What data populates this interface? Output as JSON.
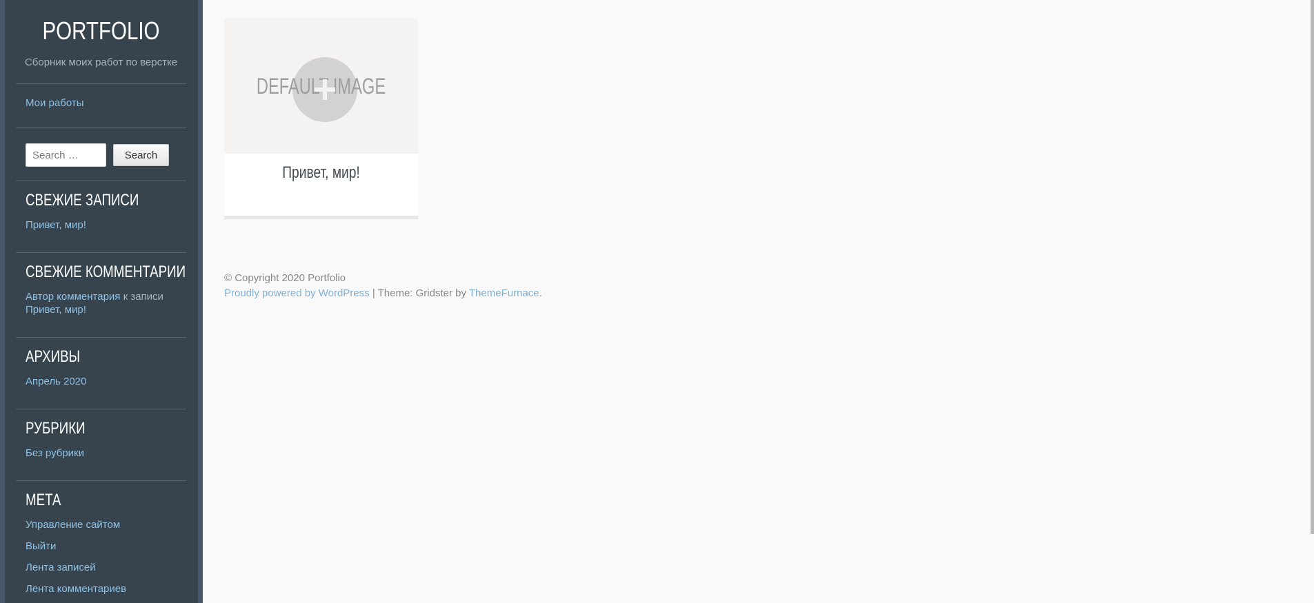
{
  "site": {
    "title": "PORTFOLIO",
    "description": "Сборник моих работ по верстке"
  },
  "menu": {
    "item": "Мои работы"
  },
  "search": {
    "placeholder": "Search …",
    "button": "Search"
  },
  "widgets": {
    "recent_posts": {
      "title": "СВЕЖИЕ ЗАПИСИ",
      "item": "Привет, мир!"
    },
    "recent_comments": {
      "title": "СВЕЖИЕ КОММЕНТАРИИ",
      "author": "Автор комментария",
      "connector": " к записи ",
      "post": "Привет, мир!"
    },
    "archives": {
      "title": "АРХИВЫ",
      "item": "Апрель 2020"
    },
    "categories": {
      "title": "РУБРИКИ",
      "item": "Без рубрики"
    },
    "meta": {
      "title": "МЕТА",
      "items": [
        "Управление сайтом",
        "Выйти",
        "Лента записей",
        "Лента комментариев"
      ]
    }
  },
  "post_card": {
    "image_text": "DEFAULT IMAGE",
    "title": "Привет, мир!"
  },
  "footer": {
    "copyright": "© Copyright 2020 Portfolio",
    "powered": "Proudly powered by WordPress",
    "theme_sep": " | Theme: Gridster by ",
    "theme_link": "ThemeFurnace."
  }
}
